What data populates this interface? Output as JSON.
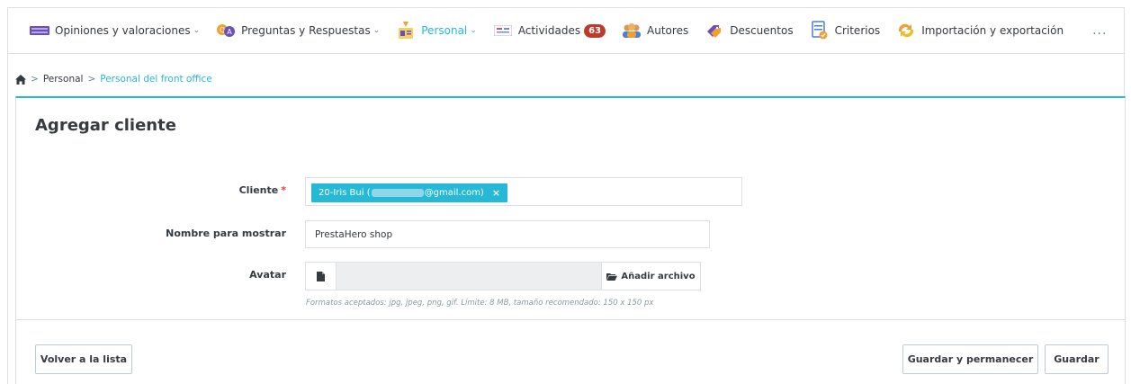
{
  "nav": {
    "items": [
      {
        "label": "Opiniones y valoraciones",
        "icon": "keyboard-icon",
        "chevron": true
      },
      {
        "label": "Preguntas y Respuestas",
        "icon": "qa-icon",
        "chevron": true
      },
      {
        "label": "Personal",
        "icon": "staff-icon",
        "chevron": true,
        "active": true
      },
      {
        "label": "Actividades",
        "icon": "activity-icon",
        "badge": "63"
      },
      {
        "label": "Autores",
        "icon": "authors-icon"
      },
      {
        "label": "Descuentos",
        "icon": "discount-tag-icon"
      },
      {
        "label": "Criterios",
        "icon": "criteria-icon"
      },
      {
        "label": "Importación y exportación",
        "icon": "import-export-icon"
      }
    ],
    "more": "..."
  },
  "breadcrumb": {
    "items": [
      "Personal",
      "Personal del front office"
    ],
    "separator": ">"
  },
  "panel": {
    "title": "Agregar cliente"
  },
  "form": {
    "customer_label": "Cliente",
    "required_mark": "*",
    "customer_tag_prefix": "20-Iris Bui (",
    "customer_tag_suffix": "@gmail.com)",
    "tag_remove": "×",
    "display_name_label": "Nombre para mostrar",
    "display_name_value": "PrestaHero shop",
    "avatar_label": "Avatar",
    "add_file_label": "Añadir archivo",
    "help_text": "Formatos aceptados: jpg, jpeg, png, gif. Límite: 8 MB, tamaño recomendado: 150 x 150 px"
  },
  "footer": {
    "back_label": "Volver a la lista",
    "save_stay_label": "Guardar y permanecer",
    "save_label": "Guardar"
  },
  "colors": {
    "accent": "#25b9d7",
    "badge": "#c0392b",
    "required": "#e53935"
  }
}
